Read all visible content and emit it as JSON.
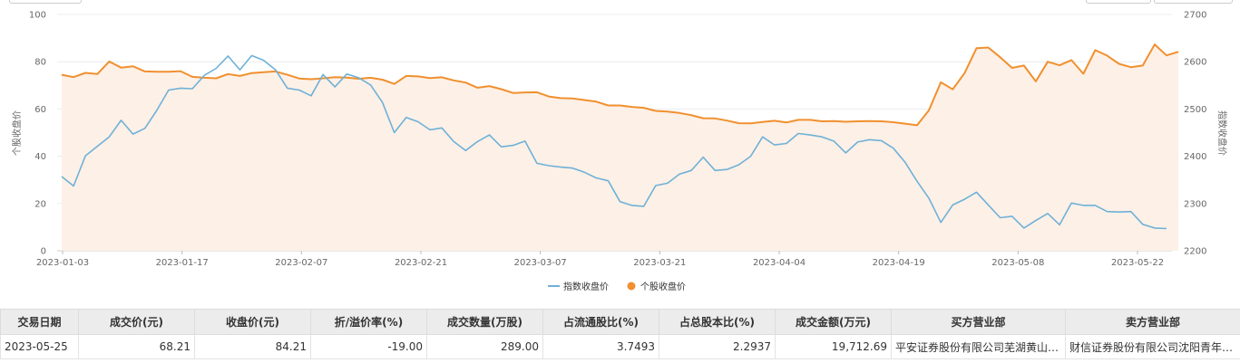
{
  "chart_data": {
    "type": "line",
    "xlabels": [
      "2023-01-03",
      "2023-01-17",
      "2023-02-07",
      "2023-02-21",
      "2023-03-07",
      "2023-03-21",
      "2023-04-04",
      "2023-04-19",
      "2023-05-08",
      "2023-05-22"
    ],
    "y_left": {
      "label": "个股收盘价",
      "ticks": [
        "0",
        "20",
        "40",
        "60",
        "80",
        "100"
      ],
      "range": [
        0,
        100
      ]
    },
    "y_right": {
      "label": "指数收盘价",
      "ticks": [
        "2200",
        "2300",
        "2400",
        "2500",
        "2600",
        "2700"
      ],
      "range": [
        2200,
        2700
      ]
    },
    "grid": true,
    "legend_position": "bottom",
    "series": [
      {
        "name": "指数收盘价",
        "axis": "right",
        "color": "#6fb1d8",
        "values": [
          2357,
          2337,
          2401,
          2421,
          2441,
          2476,
          2447,
          2459,
          2497,
          2540,
          2544,
          2543,
          2571,
          2586,
          2612,
          2583,
          2613,
          2603,
          2583,
          2544,
          2540,
          2528,
          2573,
          2547,
          2574,
          2566,
          2551,
          2514,
          2450,
          2482,
          2473,
          2456,
          2460,
          2431,
          2412,
          2431,
          2445,
          2420,
          2423,
          2432,
          2385,
          2380,
          2377,
          2375,
          2366,
          2354,
          2348,
          2304,
          2296,
          2294,
          2338,
          2343,
          2362,
          2370,
          2398,
          2370,
          2372,
          2382,
          2400,
          2441,
          2424,
          2427,
          2448,
          2445,
          2441,
          2432,
          2407,
          2430,
          2435,
          2433,
          2417,
          2387,
          2347,
          2311,
          2260,
          2297,
          2309,
          2324,
          2297,
          2270,
          2273,
          2248,
          2264,
          2279,
          2255,
          2301,
          2296,
          2296,
          2283,
          2282,
          2283,
          2256,
          2248,
          2247
        ]
      },
      {
        "name": "个股收盘价",
        "axis": "left",
        "color": "#f0902f",
        "fill": "#fdf0e6",
        "values": [
          74.5,
          73.5,
          75.3,
          74.8,
          80.1,
          77.5,
          78.1,
          75.9,
          75.8,
          75.8,
          76.0,
          73.6,
          73.2,
          73.0,
          74.8,
          74.0,
          75.2,
          75.6,
          75.9,
          74.5,
          72.9,
          72.6,
          73.0,
          73.5,
          73.3,
          72.8,
          73.2,
          72.4,
          70.6,
          74.0,
          73.8,
          73.1,
          73.4,
          72.1,
          71.2,
          69.0,
          69.7,
          68.4,
          66.8,
          67.0,
          67.1,
          65.3,
          64.6,
          64.5,
          63.8,
          63.1,
          61.5,
          61.5,
          60.9,
          60.5,
          59.2,
          58.9,
          58.3,
          57.4,
          56.1,
          56.0,
          55.1,
          54.0,
          53.9,
          54.5,
          55.0,
          54.3,
          55.4,
          55.4,
          54.8,
          54.9,
          54.6,
          54.8,
          54.9,
          54.8,
          54.4,
          53.8,
          53.1,
          59.5,
          71.3,
          68.3,
          75.2,
          85.7,
          86.0,
          81.9,
          77.4,
          78.4,
          71.7,
          80.0,
          78.5,
          80.7,
          74.9,
          84.9,
          82.6,
          79.1,
          77.7,
          78.4,
          87.3,
          82.7,
          84.2
        ]
      }
    ]
  },
  "table": {
    "columns": [
      "交易日期",
      "成交价(元)",
      "收盘价(元)",
      "折/溢价率(%)",
      "成交数量(万股)",
      "占流通股比(%)",
      "占总股本比(%)",
      "成交金额(万元)",
      "买方营业部",
      "卖方营业部"
    ],
    "rows": [
      [
        "2023-05-25",
        "68.21",
        "84.21",
        "-19.00",
        "289.00",
        "3.7493",
        "2.2937",
        "19,712.69",
        "平安证券股份有限公司芜湖黄山…",
        "财信证券股份有限公司沈阳青年…"
      ]
    ]
  }
}
